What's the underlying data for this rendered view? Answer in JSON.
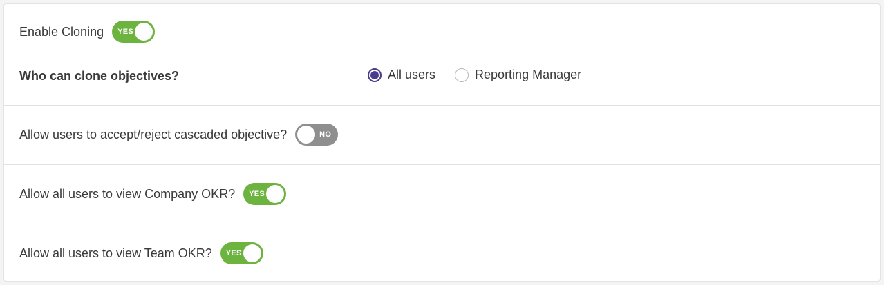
{
  "settings": {
    "cloning": {
      "label": "Enable Cloning",
      "toggle_state": "on",
      "toggle_text": "YES",
      "who_can_clone_label": "Who can clone objectives?",
      "options": [
        {
          "label": "All users",
          "selected": true
        },
        {
          "label": "Reporting Manager",
          "selected": false
        }
      ]
    },
    "accept_reject": {
      "label": "Allow users to accept/reject cascaded objective?",
      "toggle_state": "off",
      "toggle_text": "NO"
    },
    "company_okr": {
      "label": "Allow all users to view Company OKR?",
      "toggle_state": "on",
      "toggle_text": "YES"
    },
    "team_okr": {
      "label": "Allow all users to view Team OKR?",
      "toggle_state": "on",
      "toggle_text": "YES"
    }
  },
  "colors": {
    "toggle_on": "#6cb33f",
    "toggle_off": "#8f8f8f",
    "radio_selected": "#4a3c8c"
  }
}
